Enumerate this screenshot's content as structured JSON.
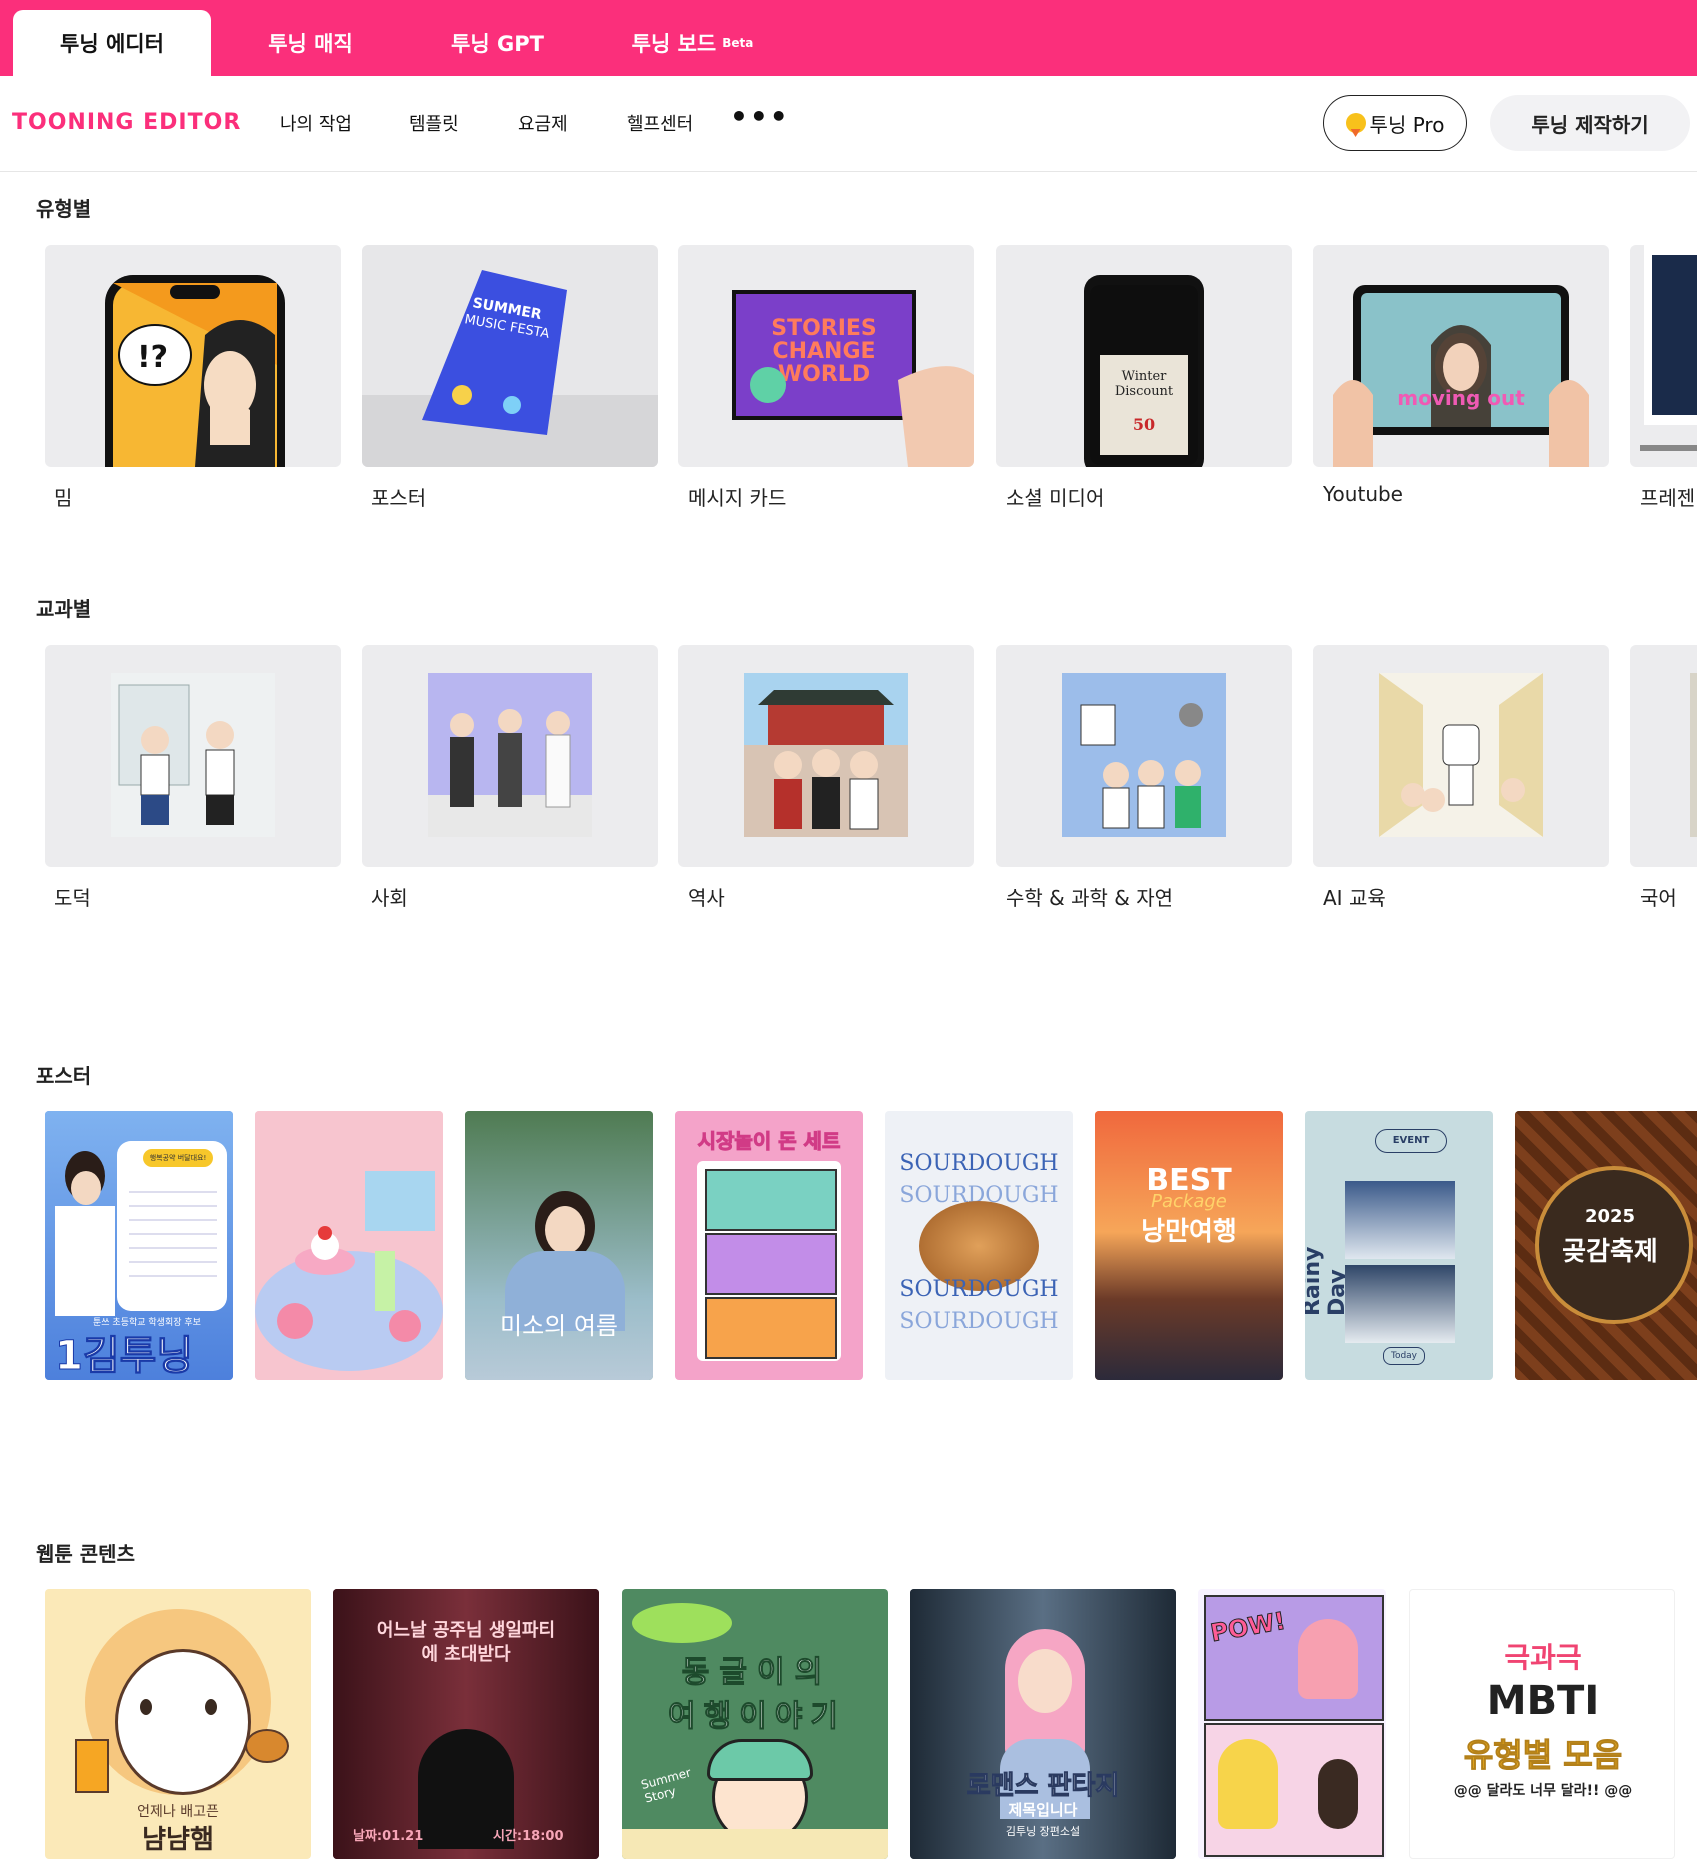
{
  "top_tabs": [
    {
      "label": "투닝 에디터",
      "active": true
    },
    {
      "label": "투닝 매직"
    },
    {
      "label": "투닝 GPT"
    },
    {
      "label": "투닝 보드",
      "badge": "Beta"
    }
  ],
  "logo": {
    "text": "TOONING EDITOR"
  },
  "nav": {
    "links": [
      "나의 작업",
      "템플릿",
      "요금제",
      "헬프센터"
    ],
    "more": "•••",
    "pro_label": "투닝 Pro",
    "make_label": "투닝 제작하기"
  },
  "sections": {
    "by_type": {
      "title": "유형별",
      "items": [
        "밈",
        "포스터",
        "메시지 카드",
        "소셜 미디어",
        "Youtube",
        "프레젠"
      ]
    },
    "by_subject": {
      "title": "교과별",
      "items": [
        "도덕",
        "사회",
        "역사",
        "수학 & 과학 & 자연",
        "AI 교육",
        "국어"
      ]
    },
    "posters": {
      "title": "포스터",
      "texts": {
        "p1_big": "1김투닝",
        "p1_sub": "툰쓰 초등학교 학생회장 후보",
        "p1_badge": "행복공약 버달대요!",
        "p3_title": "미소의 여름",
        "p4_title": "시장놀이 돈 세트",
        "p5_word": "SOURDOUGH",
        "p6_title": "BEST",
        "p6_script": "Package",
        "p6_kr": "낭만여행",
        "p7_side": "Rainy Day",
        "p7_event": "EVENT",
        "p7_today": "Today",
        "p8_year": "2025",
        "p8_title": "곶감축제"
      }
    },
    "webtoon": {
      "title": "웹툰 콘텐츠",
      "texts": {
        "w1_small": "언제나 배고픈",
        "w1_big": "냠냠햄",
        "w2_title": "어느날 공주님 생일파티에 초대받다",
        "w2_left": "날짜:01.21",
        "w2_right": "시간:18:00",
        "w3_line1": "동글이의",
        "w3_line2": "여행이야기",
        "w3_summer": "Summer Story",
        "w4_title": "로맨스 판타지",
        "w4_sub": "제목입니다",
        "w4_foot": "김투닝 장편소설",
        "w5_pow": "POW!",
        "w6_line1": "극과극",
        "w6_line2": "MBTI",
        "w6_line3": "유형별 모음",
        "w6_line4": "@@ 달라도 너무 달라!! @@"
      }
    }
  },
  "colors": {
    "brand": "#fb2f7b",
    "card_bg": "#ececee"
  }
}
